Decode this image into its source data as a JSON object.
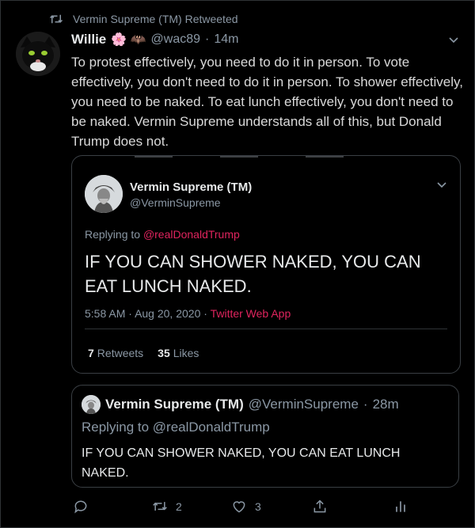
{
  "retweet": {
    "text": "Vermin Supreme (TM) Retweeted",
    "icon": "retweet-icon"
  },
  "tweet": {
    "name": "Willie",
    "emoji": "🌸 🦇",
    "handle": "@wac89",
    "sep": "·",
    "time": "14m",
    "text": "To protest effectively, you need to do it in person. To vote effectively, you don't need to do it in person. To shower effectively, you need to be naked. To eat lunch effectively, you don't need to be naked. Vermin Supreme understands all of this, but Donald Trump does not."
  },
  "quoted": {
    "name": "Vermin Supreme (TM)",
    "handle": "@VerminSupreme",
    "replying_prefix": "Replying to ",
    "replying_to": "@realDonaldTrump",
    "text": "IF YOU CAN SHOWER NAKED, YOU CAN EAT LUNCH NAKED.",
    "time": "5:58 AM",
    "sep": "·",
    "date": "Aug 20, 2020",
    "sep2": "·",
    "client": "Twitter Web App",
    "retweets_count": "7",
    "retweets_label": "Retweets",
    "likes_count": "35",
    "likes_label": "Likes"
  },
  "inner_quote": {
    "name": "Vermin Supreme (TM)",
    "handle": "@VerminSupreme",
    "sep": "·",
    "time": "28m",
    "replying": "Replying to @realDonaldTrump",
    "text": "IF YOU CAN SHOWER NAKED, YOU CAN EAT LUNCH NAKED."
  },
  "actions": {
    "reply_count": "",
    "retweet_count": "2",
    "like_count": "3"
  },
  "colors": {
    "accent_pink": "#e0245e",
    "muted": "#8b98a5",
    "background": "#000000"
  }
}
